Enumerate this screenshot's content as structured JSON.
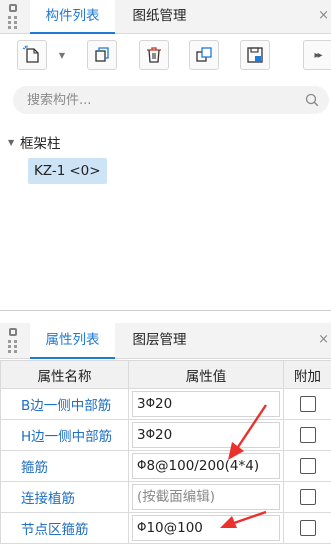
{
  "top_panel": {
    "tabs": [
      {
        "label": "构件列表",
        "active": true
      },
      {
        "label": "图纸管理",
        "active": false
      }
    ],
    "close_glyph": "×",
    "toolbar": {
      "buttons": [
        "new-component-icon",
        "copy-icon",
        "delete-icon",
        "layer-copy-icon",
        "save-template-icon"
      ],
      "more_glyph": "▸▸"
    },
    "search": {
      "placeholder": "搜索构件...",
      "value": ""
    },
    "tree": {
      "root_label": "框架柱",
      "items": [
        {
          "name": "KZ-1",
          "count": "<0>",
          "selected": true
        }
      ]
    }
  },
  "bottom_panel": {
    "tabs": [
      {
        "label": "属性列表",
        "active": true
      },
      {
        "label": "图层管理",
        "active": false
      }
    ],
    "close_glyph": "×",
    "table": {
      "headers": {
        "name": "属性名称",
        "value": "属性值",
        "extra": "附加"
      },
      "rows": [
        {
          "name": "B边一侧中部筋",
          "rebar": "Φ",
          "value_pre": "3",
          "value_post": "20",
          "placeholder": false,
          "checked": false
        },
        {
          "name": "H边一侧中部筋",
          "rebar": "Φ",
          "value_pre": "3",
          "value_post": "20",
          "placeholder": false,
          "checked": false
        },
        {
          "name": "箍筋",
          "rebar": "Φ",
          "value_pre": "",
          "value_post": "8@100/200(4*4)",
          "placeholder": false,
          "checked": false
        },
        {
          "name": "连接植筋",
          "rebar": "",
          "value_pre": "(按截面编辑)",
          "value_post": "",
          "placeholder": true,
          "checked": false
        },
        {
          "name": "节点区箍筋",
          "rebar": "Φ",
          "value_pre": "",
          "value_post": "10@100",
          "placeholder": false,
          "checked": false
        }
      ]
    }
  },
  "colors": {
    "accent": "#1f7ad6",
    "link": "#1f6fc2",
    "selected_bg": "#cde3f6",
    "annotation_arrow": "#e8322b"
  }
}
